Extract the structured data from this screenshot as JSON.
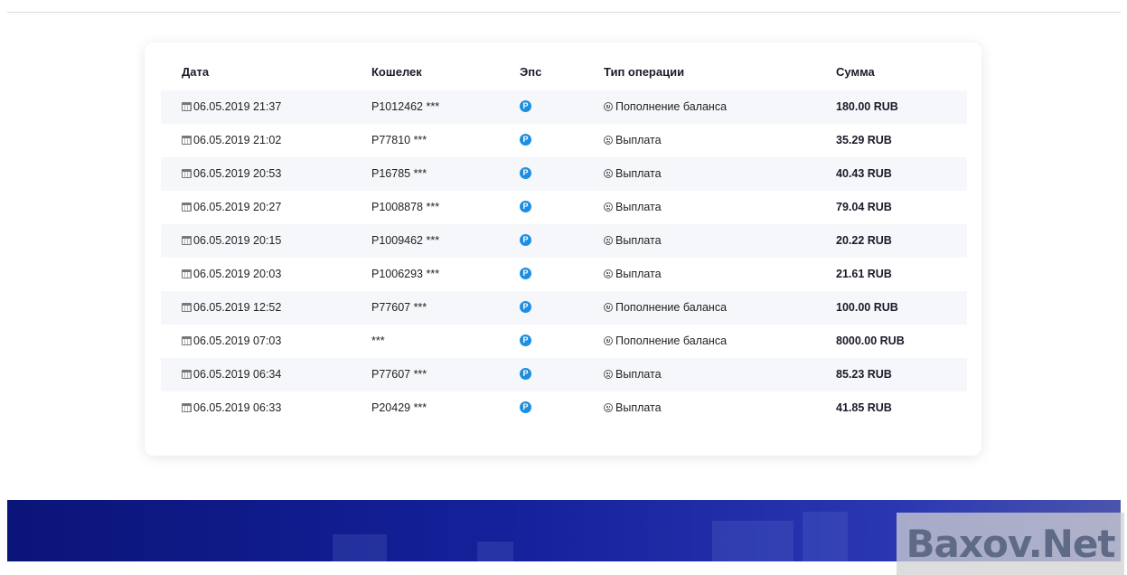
{
  "table": {
    "headers": {
      "date": "Дата",
      "wallet": "Кошелек",
      "eps": "Эпс",
      "type": "Тип операции",
      "sum": "Сумма"
    },
    "eps_glyph": "P",
    "rows": [
      {
        "date": "06.05.2019 21:37",
        "wallet": "P1012462 ***",
        "type": "Пополнение баланса",
        "mood": "smile",
        "sum": "180.00 RUB"
      },
      {
        "date": "06.05.2019 21:02",
        "wallet": "P77810 ***",
        "type": "Выплата",
        "mood": "frown",
        "sum": "35.29 RUB"
      },
      {
        "date": "06.05.2019 20:53",
        "wallet": "P16785 ***",
        "type": "Выплата",
        "mood": "frown",
        "sum": "40.43 RUB"
      },
      {
        "date": "06.05.2019 20:27",
        "wallet": "P1008878 ***",
        "type": "Выплата",
        "mood": "frown",
        "sum": "79.04 RUB"
      },
      {
        "date": "06.05.2019 20:15",
        "wallet": "P1009462 ***",
        "type": "Выплата",
        "mood": "frown",
        "sum": "20.22 RUB"
      },
      {
        "date": "06.05.2019 20:03",
        "wallet": "P1006293 ***",
        "type": "Выплата",
        "mood": "frown",
        "sum": "21.61 RUB"
      },
      {
        "date": "06.05.2019 12:52",
        "wallet": "P77607 ***",
        "type": "Пополнение баланса",
        "mood": "smile",
        "sum": "100.00 RUB"
      },
      {
        "date": "06.05.2019 07:03",
        "wallet": "***",
        "type": "Пополнение баланса",
        "mood": "smile",
        "sum": "8000.00 RUB"
      },
      {
        "date": "06.05.2019 06:34",
        "wallet": "P77607 ***",
        "type": "Выплата",
        "mood": "frown",
        "sum": "85.23 RUB"
      },
      {
        "date": "06.05.2019 06:33",
        "wallet": "P20429 ***",
        "type": "Выплата",
        "mood": "frown",
        "sum": "41.85 RUB"
      }
    ]
  },
  "watermark": "Baxov.Net",
  "colors": {
    "accent": "#1e8fe0",
    "footer": "#14219b"
  },
  "icons": {
    "date": "calendar-icon",
    "eps": "payeer-icon",
    "deposit": "smile-icon",
    "payout": "frown-icon"
  }
}
